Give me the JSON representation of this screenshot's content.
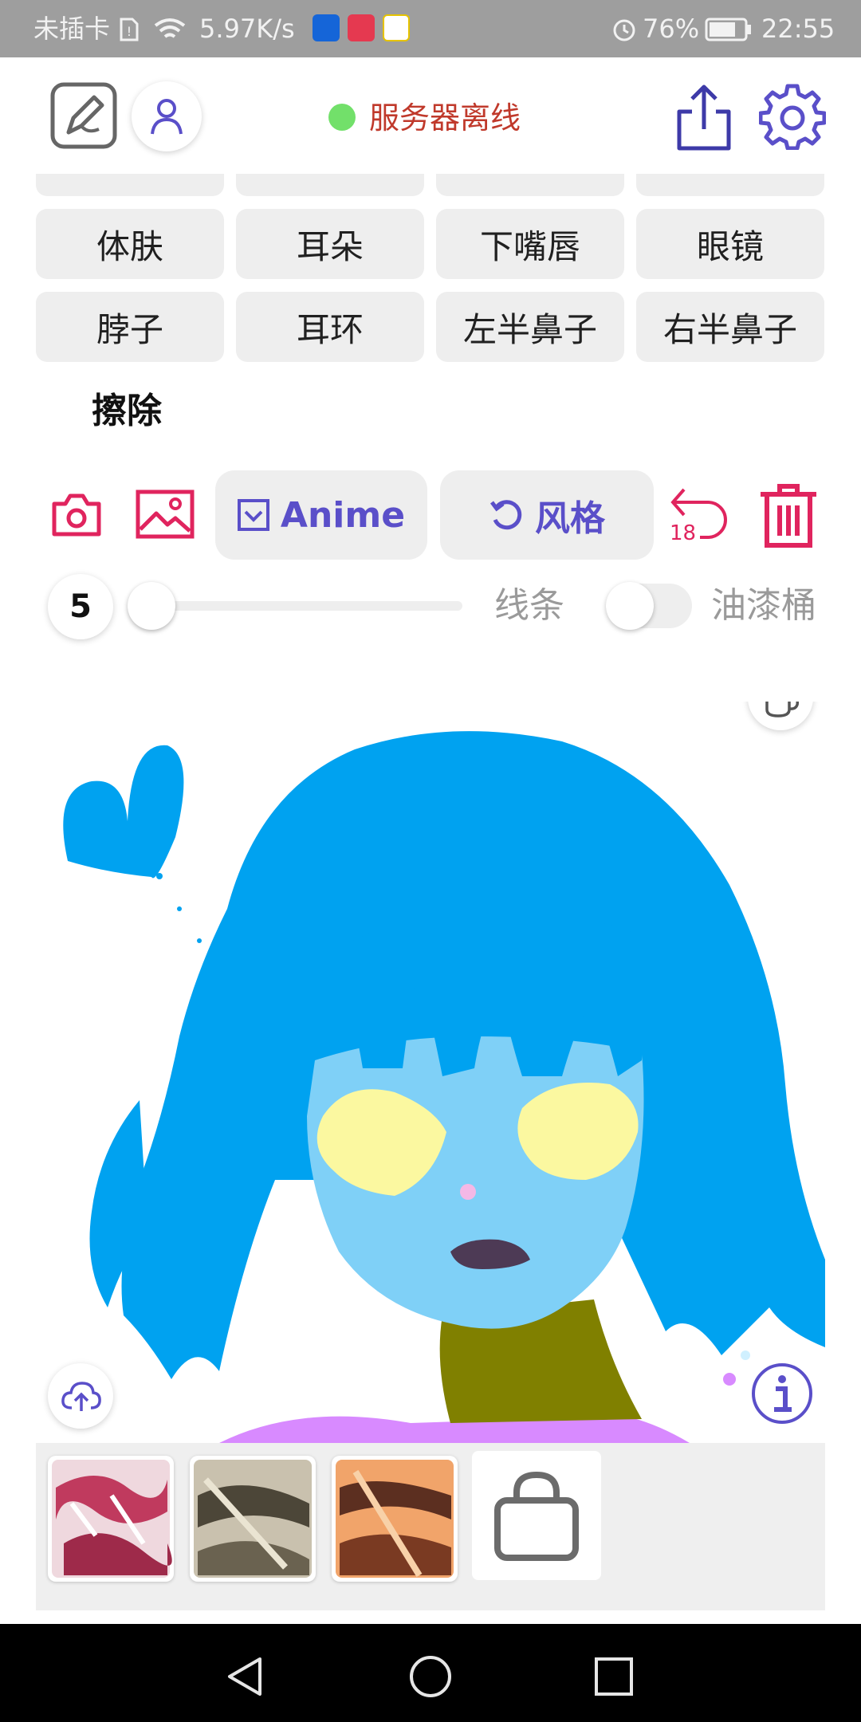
{
  "status_bar": {
    "carrier": "未插卡",
    "speed": "5.97K/s",
    "battery": "76%",
    "time": "22:55"
  },
  "header": {
    "status_text": "服务器离线",
    "status_color": "#72e06a",
    "icons": [
      "edit-icon",
      "user-icon",
      "share-icon",
      "settings-icon"
    ]
  },
  "parts": {
    "row1": [
      "体肤",
      "耳朵",
      "下嘴唇",
      "眼镜"
    ],
    "row2": [
      "脖子",
      "耳环",
      "左半鼻子",
      "右半鼻子"
    ],
    "erase": "擦除"
  },
  "toolbar": {
    "anime_label": "Anime",
    "style_label": "风格",
    "undo_count": "18",
    "accent": "#e0245e",
    "primary": "#5a4fc9"
  },
  "brush": {
    "size": "5",
    "lines_label": "线条",
    "bucket_label": "油漆桶",
    "slider_level": 0.0,
    "bucket_enabled": false
  },
  "styles": {
    "items": [
      "style-thumb-red",
      "style-thumb-gray",
      "style-thumb-orange"
    ],
    "store_icon": "shopping-bag-icon"
  }
}
